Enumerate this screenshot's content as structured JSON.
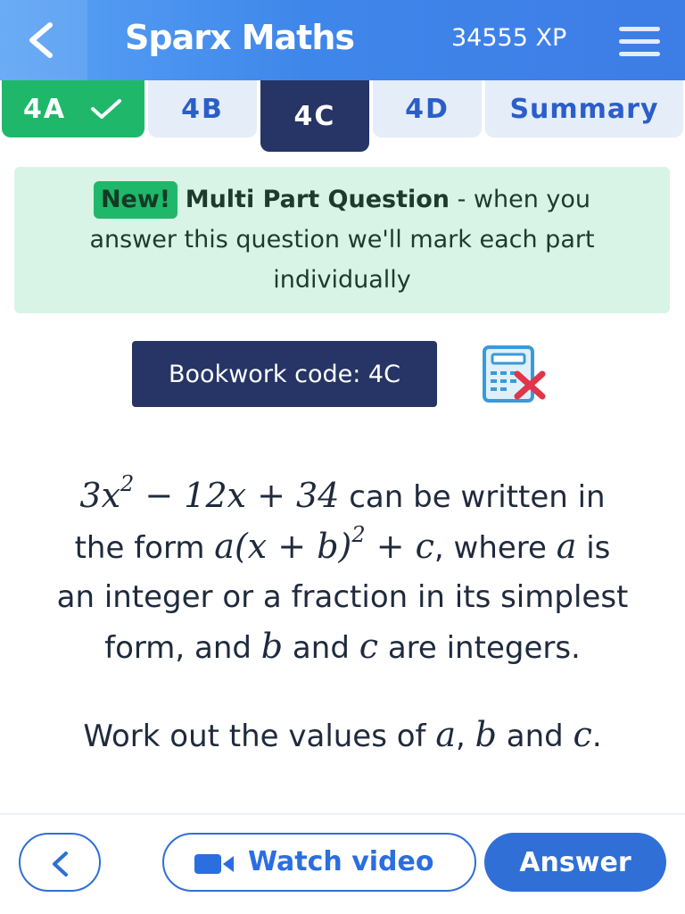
{
  "header": {
    "app_title": "Sparx Maths",
    "xp": "34555 XP",
    "back_icon": "chevron-left-icon",
    "menu_icon": "hamburger-menu-icon",
    "gradient_start": "#5aa3f5",
    "gradient_end": "#3d7de6"
  },
  "tabs": [
    {
      "label": "4A",
      "state": "completed",
      "color": "#1fb86a"
    },
    {
      "label": "4B",
      "state": "default",
      "color": "#e5edf8"
    },
    {
      "label": "4C",
      "state": "active",
      "color": "#263565"
    },
    {
      "label": "4D",
      "state": "default",
      "color": "#e5edf8"
    },
    {
      "label": "Summary",
      "state": "default",
      "color": "#e5edf8"
    }
  ],
  "banner": {
    "badge": "New!",
    "title": "Multi Part Question",
    "text_after_title": " - when you",
    "line2": "answer this question we'll mark each part",
    "line3": "individually",
    "background": "#d8f4e6"
  },
  "bookwork": {
    "label": "Bookwork code: 4C",
    "calculator_icon": "calculator-not-allowed-icon"
  },
  "question": {
    "expr_3x": "3x",
    "expr_sq": "2",
    "expr_rest": " − 12x + 34",
    "t1": " can be written in",
    "t2": "the form ",
    "form_a": "a",
    "form_paren": "(x + b)",
    "form_sq": "2",
    "form_c": " + c",
    "t3": ", where ",
    "var_a": "a",
    "t4": " is",
    "line3": "an integer or a fraction in its simplest",
    "t5": "form, and ",
    "var_b": "b",
    "t6": " and ",
    "var_c": "c",
    "t7": " are integers.",
    "work_t1": "Work out the values of ",
    "work_a": "a",
    "work_comma": ", ",
    "work_b": "b",
    "work_and": " and ",
    "work_c": "c",
    "work_dot": "."
  },
  "footer": {
    "back_icon": "chevron-left-icon",
    "video_icon": "video-camera-icon",
    "watch_video": "Watch video",
    "answer": "Answer",
    "primary_color": "#2f6fd6"
  }
}
